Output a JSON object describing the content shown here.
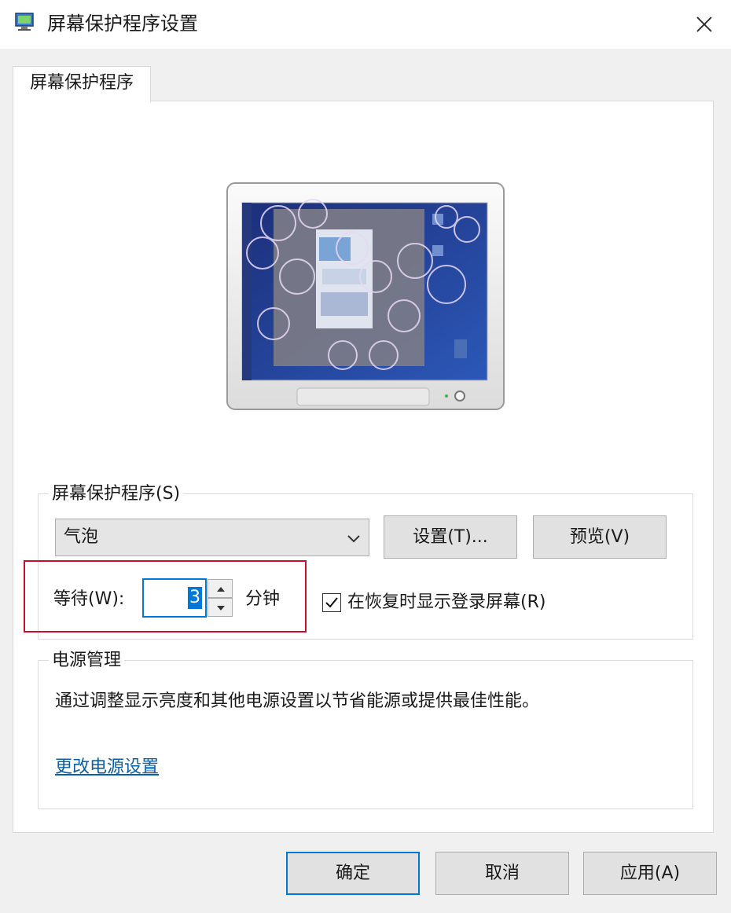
{
  "window": {
    "title": "屏幕保护程序设置",
    "close_icon": "close-icon"
  },
  "tab": {
    "label": "屏幕保护程序"
  },
  "screensaver": {
    "group_label": "屏幕保护程序(S)",
    "selected": "气泡",
    "settings_button": "设置(T)...",
    "preview_button": "预览(V)",
    "wait_label": "等待(W):",
    "wait_value": "3",
    "minutes_label": "分钟",
    "resume_checkbox_label": "在恢复时显示登录屏幕(R)",
    "resume_checked": true
  },
  "power": {
    "group_label": "电源管理",
    "description": "通过调整显示亮度和其他电源设置以节省能源或提供最佳性能。",
    "link": "更改电源设置"
  },
  "footer": {
    "ok": "确定",
    "cancel": "取消",
    "apply": "应用(A)"
  },
  "colors": {
    "accent": "#0078d7",
    "highlight_box": "#c8102e",
    "link": "#0b5fa5"
  }
}
